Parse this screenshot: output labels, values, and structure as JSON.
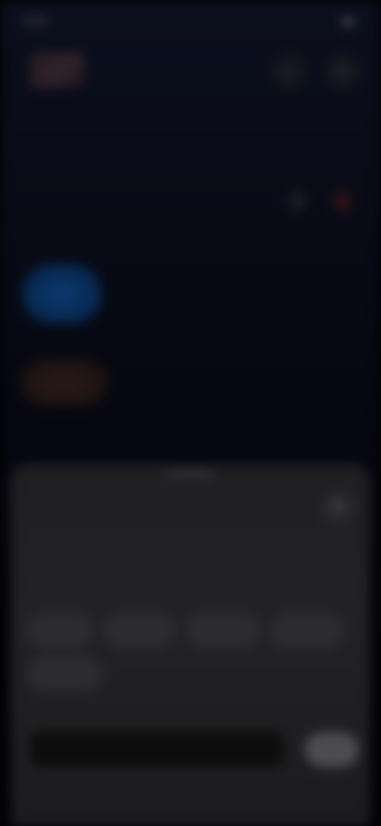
{
  "status_bar": {
    "time": "9:41",
    "icons": "▮▮"
  },
  "header": {
    "title": "",
    "icon_one": "video-icon",
    "icon_two": "phone-icon"
  },
  "chat": {
    "meta": "",
    "message_line": ""
  },
  "sheet": {
    "title": "",
    "subtitle": "",
    "chips": [
      "",
      "",
      "",
      "",
      ""
    ],
    "label": "",
    "input_placeholder": "",
    "send_label": ""
  },
  "colors": {
    "background": "#05040c",
    "sheet": "#1f1f21",
    "bubble_blue": "#0b3a6e",
    "bubble_brown": "#2a1a16"
  }
}
